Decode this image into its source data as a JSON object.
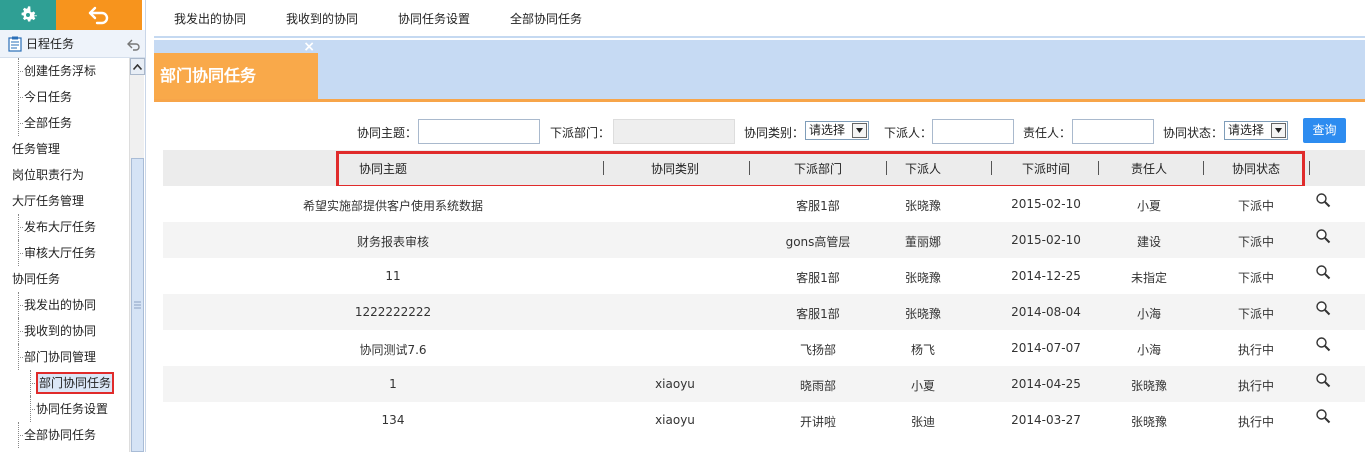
{
  "sidebar": {
    "header_title": "日程任务",
    "items": [
      {
        "label": "创建任务浮标",
        "level": 1
      },
      {
        "label": "今日任务",
        "level": 1
      },
      {
        "label": "全部任务",
        "level": 1
      },
      {
        "label": "任务管理",
        "level": 0
      },
      {
        "label": "岗位职责行为",
        "level": 0
      },
      {
        "label": "大厅任务管理",
        "level": 0
      },
      {
        "label": "发布大厅任务",
        "level": 1
      },
      {
        "label": "审核大厅任务",
        "level": 1
      },
      {
        "label": "协同任务",
        "level": 0
      },
      {
        "label": "我发出的协同",
        "level": 1
      },
      {
        "label": "我收到的协同",
        "level": 1
      },
      {
        "label": "部门协同管理",
        "level": 1
      },
      {
        "label": "部门协同任务",
        "level": 2,
        "active": true
      },
      {
        "label": "协同任务设置",
        "level": 2
      },
      {
        "label": "全部协同任务",
        "level": 1
      }
    ]
  },
  "top_tabs": [
    "我发出的协同",
    "我收到的协同",
    "协同任务设置",
    "全部协同任务"
  ],
  "banner": {
    "title": "部门协同任务",
    "close": "×"
  },
  "filters": {
    "topic_label": "协同主题：",
    "dept_label": "下派部门：",
    "category_label": "协同类别：",
    "category_value": "请选择",
    "assigner_label": "下派人：",
    "owner_label": "责任人：",
    "status_label": "协同状态：",
    "status_value": "请选择",
    "query_button": "查询"
  },
  "table": {
    "headers": [
      "协同主题",
      "协同类别",
      "下派部门",
      "下派人",
      "下派时间",
      "责任人",
      "协同状态"
    ],
    "rows": [
      [
        "希望实施部提供客户使用系统数据",
        "",
        "客服1部",
        "张晓豫",
        "2015-02-10",
        "小夏",
        "下派中"
      ],
      [
        "财务报表审核",
        "",
        "gons高管层",
        "董丽娜",
        "2015-02-10",
        "建设",
        "下派中"
      ],
      [
        "11",
        "",
        "客服1部",
        "张晓豫",
        "2014-12-25",
        "未指定",
        "下派中"
      ],
      [
        "1222222222",
        "",
        "客服1部",
        "张晓豫",
        "2014-08-04",
        "小海",
        "下派中"
      ],
      [
        "协同测试7.6",
        "",
        "飞扬部",
        "杨飞",
        "2014-07-07",
        "小海",
        "执行中"
      ],
      [
        "1",
        "xiaoyu",
        "晓雨部",
        "小夏",
        "2014-04-25",
        "张晓豫",
        "执行中"
      ],
      [
        "134",
        "xiaoyu",
        "开讲啦",
        "张迪",
        "2014-03-27",
        "张晓豫",
        "执行中"
      ]
    ]
  },
  "colors": {
    "accent_orange": "#f7941d",
    "accent_teal": "#2f9f94",
    "highlight_red": "#e02b2b",
    "query_blue": "#2d8cf0"
  }
}
